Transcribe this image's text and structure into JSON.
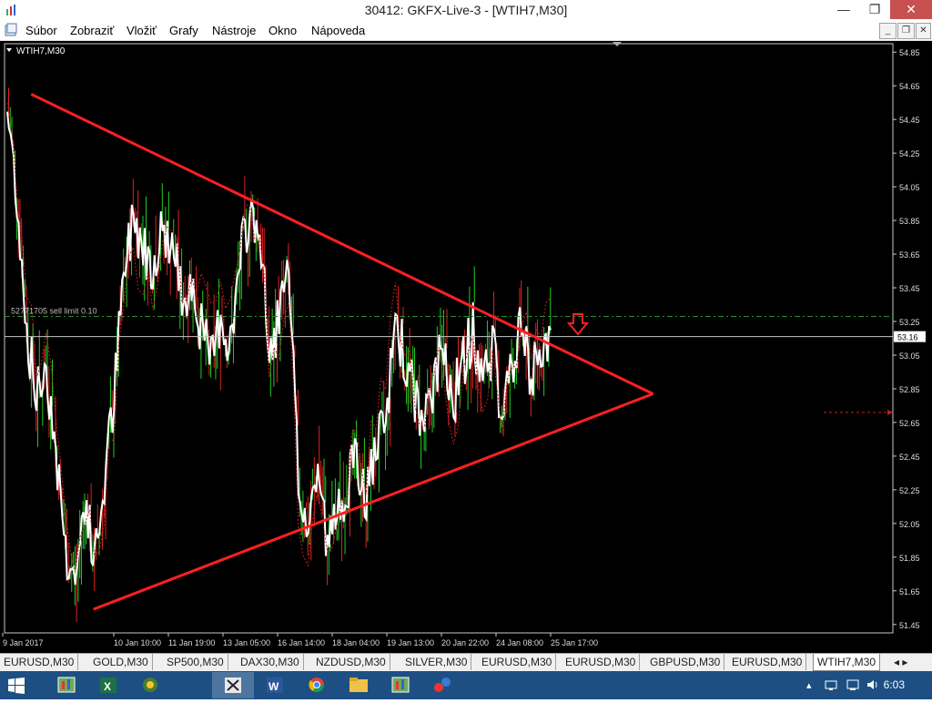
{
  "window": {
    "title": "30412: GKFX-Live-3 - [WTIH7,M30]"
  },
  "menu": [
    "Súbor",
    "Zobraziť",
    "Vložiť",
    "Grafy",
    "Nástroje",
    "Okno",
    "Nápoveda"
  ],
  "chart": {
    "symbol_label": "WTIH7,M30",
    "order_label": "52771705 sell limit 0.10",
    "current_price": "53.16",
    "price_ticks": [
      "54.85",
      "54.65",
      "54.45",
      "54.25",
      "54.05",
      "53.85",
      "53.65",
      "53.45",
      "53.25",
      "53.05",
      "52.85",
      "52.65",
      "52.45",
      "52.25",
      "52.05",
      "51.85",
      "51.65",
      "51.45"
    ],
    "time_ticks": [
      "9 Jan 2017",
      "10 Jan 10:00",
      "11 Jan 19:00",
      "13 Jan 05:00",
      "16 Jan 14:00",
      "18 Jan 04:00",
      "19 Jan 13:00",
      "20 Jan 22:00",
      "24 Jan 08:00",
      "25 Jan 17:00"
    ]
  },
  "chart_data": {
    "type": "line",
    "y_range": [
      51.4,
      54.9
    ],
    "order_level": 53.28,
    "current_price": 53.16,
    "trendlines": [
      {
        "name": "upper",
        "from": [
          0.03,
          54.6
        ],
        "to": [
          0.73,
          52.82
        ]
      },
      {
        "name": "lower",
        "from": [
          0.1,
          51.54
        ],
        "to": [
          0.73,
          52.82
        ]
      }
    ],
    "series_close": [
      54.5,
      54.0,
      53.2,
      52.8,
      53.0,
      52.5,
      51.9,
      51.7,
      52.2,
      51.8,
      52.3,
      52.8,
      53.5,
      53.9,
      53.7,
      53.6,
      53.8,
      53.7,
      53.4,
      53.5,
      53.2,
      53.0,
      53.3,
      53.1,
      53.6,
      53.9,
      53.8,
      53.0,
      53.3,
      53.5,
      52.3,
      52.0,
      52.4,
      51.9,
      52.1,
      52.3,
      52.4,
      52.2,
      52.5,
      52.6,
      53.3,
      53.0,
      52.8,
      52.6,
      52.9,
      53.1,
      52.8,
      53.0,
      53.2,
      52.9,
      53.1,
      52.7,
      53.0,
      53.2,
      52.9,
      53.1,
      53.2
    ]
  },
  "tabs": [
    "EURUSD,M30",
    "GOLD,M30",
    "SP500,M30",
    "DAX30,M30",
    "NZDUSD,M30",
    "SILVER,M30",
    "EURUSD,M30",
    "EURUSD,M30",
    "GBPUSD,M30",
    "EURUSD,M30",
    "WTIH7,M30"
  ],
  "active_tab": "WTIH7,M30",
  "taskbar": {
    "clock": "6:03"
  },
  "colors": {
    "trendline": "#ff2020",
    "bull": "#22cc22",
    "bear": "#dd2222",
    "line": "#ffffff",
    "order": "#2e8b2e"
  }
}
